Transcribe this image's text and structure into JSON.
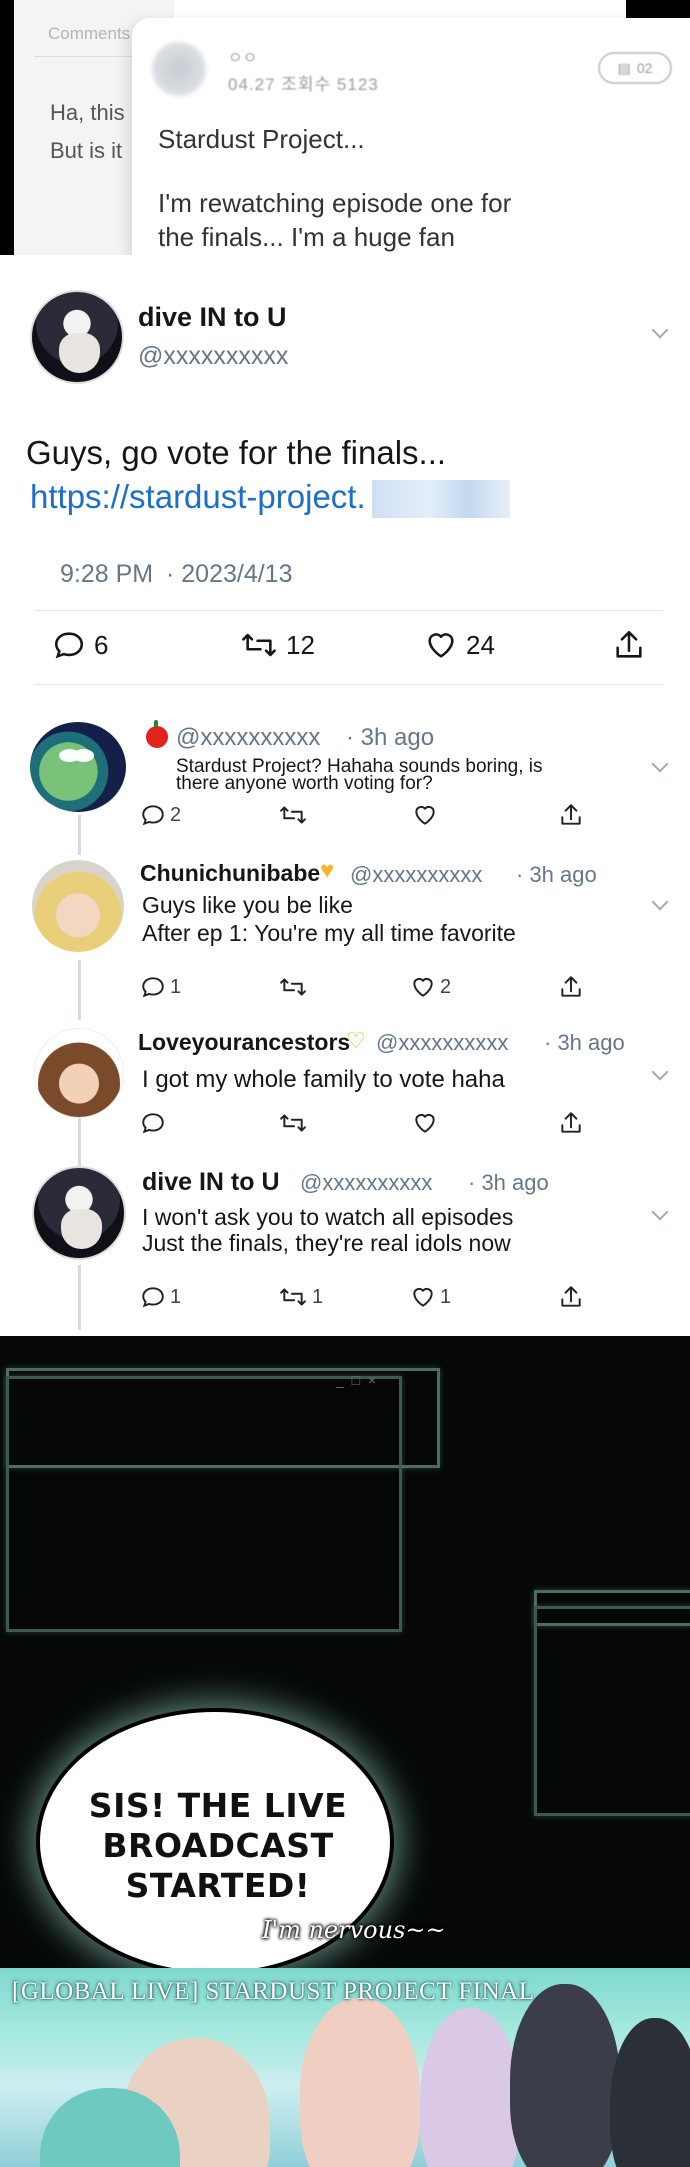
{
  "top_panel": {
    "comments_tab": "Comments",
    "bg_line1": "Ha, this",
    "bg_line2": "But is it",
    "card_user": "ㅇㅇ",
    "card_date": "04.27 조회수 5123",
    "card_pill": "02",
    "card_title": "Stardust Project...",
    "card_body_line1": "I'm rewatching episode one for",
    "card_body_line2": "the finals... I'm a huge fan"
  },
  "tweet": {
    "name": "dive IN to U",
    "handle": "@xxxxxxxxxx",
    "text": "Guys, go vote for the finals...",
    "link": "https://stardust-project.",
    "time": "9:28 PM",
    "date": "· 2023/4/13",
    "replies": "6",
    "retweets": "12",
    "likes": "24"
  },
  "replies": [
    {
      "name": "",
      "handle": "@xxxxxxxxxx",
      "time": "· 3h ago",
      "line1": "Stardust Project? Hahaha sounds boring, is",
      "line2": "there anyone worth voting for?",
      "reply_count": "2",
      "retweet_count": "",
      "like_count": ""
    },
    {
      "name": "Chunichunibabe",
      "handle": "@xxxxxxxxxx",
      "time": "· 3h ago",
      "line1": "Guys like you be like",
      "line2": "After ep 1: You're my all time favorite",
      "reply_count": "1",
      "retweet_count": "",
      "like_count": "2"
    },
    {
      "name": "Loveyourancestors",
      "handle": "@xxxxxxxxxx",
      "time": "· 3h ago",
      "line1": "I got my whole family to vote haha",
      "line2": "",
      "reply_count": "",
      "retweet_count": "",
      "like_count": ""
    },
    {
      "name": "dive IN to U",
      "handle": "@xxxxxxxxxx",
      "time": "· 3h ago",
      "line1": "I won't ask you to watch all episodes",
      "line2": "Just the finals, they're real idols now",
      "reply_count": "1",
      "retweet_count": "1",
      "like_count": "1"
    }
  ],
  "comic": {
    "window_buttons": "_ □ ×",
    "bubble_line1": "SIS! THE LIVE",
    "bubble_line2": "BROADCAST",
    "bubble_line3": "STARTED!",
    "aside": "I'm nervous~~",
    "broadcast_title": "[GLOBAL LIVE] STARDUST PROJECT FINAL"
  },
  "colors": {
    "link": "#1b6fc9",
    "muted": "#657786",
    "comic_bg": "#050807",
    "broadcast_teal": "#7fd9cf"
  }
}
